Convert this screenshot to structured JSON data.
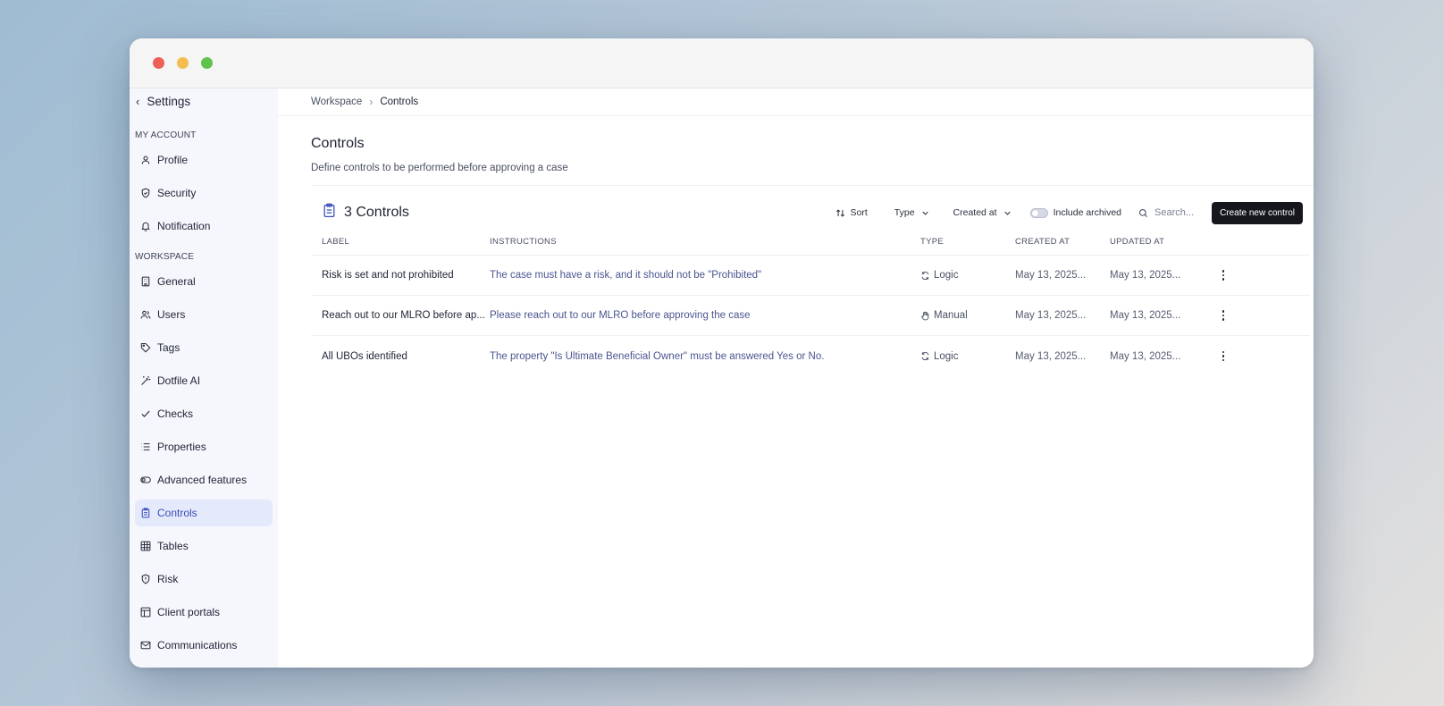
{
  "sidebar": {
    "back_label": "Settings",
    "sections": {
      "my_account": "MY ACCOUNT",
      "workspace": "WORKSPACE"
    },
    "account_items": [
      {
        "label": "Profile",
        "icon": "user-icon"
      },
      {
        "label": "Security",
        "icon": "shield-check-icon"
      },
      {
        "label": "Notification",
        "icon": "bell-icon"
      }
    ],
    "workspace_items": [
      {
        "label": "General",
        "icon": "building-icon"
      },
      {
        "label": "Users",
        "icon": "users-icon"
      },
      {
        "label": "Tags",
        "icon": "tag-icon"
      },
      {
        "label": "Dotfile AI",
        "icon": "magic-wand-icon"
      },
      {
        "label": "Checks",
        "icon": "check-icon"
      },
      {
        "label": "Properties",
        "icon": "list-icon"
      },
      {
        "label": "Advanced features",
        "icon": "toggle-icon"
      },
      {
        "label": "Controls",
        "icon": "clipboard-icon",
        "active": true
      },
      {
        "label": "Tables",
        "icon": "table-icon"
      },
      {
        "label": "Risk",
        "icon": "shield-alert-icon"
      },
      {
        "label": "Client portals",
        "icon": "layout-icon"
      },
      {
        "label": "Communications",
        "icon": "mail-icon"
      }
    ]
  },
  "breadcrumb": {
    "parent": "Workspace",
    "current": "Controls"
  },
  "page": {
    "title": "Controls",
    "description": "Define controls to be performed before approving a case"
  },
  "toolbar": {
    "count_label": "3 Controls",
    "sort_label": "Sort",
    "type_label": "Type",
    "created_label": "Created at",
    "archived_label": "Include archived",
    "search_placeholder": "Search...",
    "create_label": "Create new control"
  },
  "table": {
    "headers": {
      "label": "LABEL",
      "instructions": "INSTRUCTIONS",
      "type": "TYPE",
      "created_at": "CREATED AT",
      "updated_at": "UPDATED AT"
    },
    "rows": [
      {
        "label": "Risk is set and not prohibited",
        "instructions": "The case must have a risk, and it should not be \"Prohibited\"",
        "type": "Logic",
        "type_icon": "refresh-icon",
        "created_at": "May 13, 2025...",
        "updated_at": "May 13, 2025..."
      },
      {
        "label": "Reach out to our MLRO before ap...",
        "instructions": "Please reach out to our MLRO before approving the case",
        "type": "Manual",
        "type_icon": "hand-icon",
        "created_at": "May 13, 2025...",
        "updated_at": "May 13, 2025..."
      },
      {
        "label": "All UBOs identified",
        "instructions": "The property \"Is Ultimate Beneficial Owner\" must be answered Yes or No.",
        "type": "Logic",
        "type_icon": "refresh-icon",
        "created_at": "May 13, 2025...",
        "updated_at": "May 13, 2025..."
      }
    ]
  },
  "colors": {
    "accent": "#3a4fb8",
    "active_bg": "#e4e9fb",
    "primary_button": "#16171c"
  }
}
